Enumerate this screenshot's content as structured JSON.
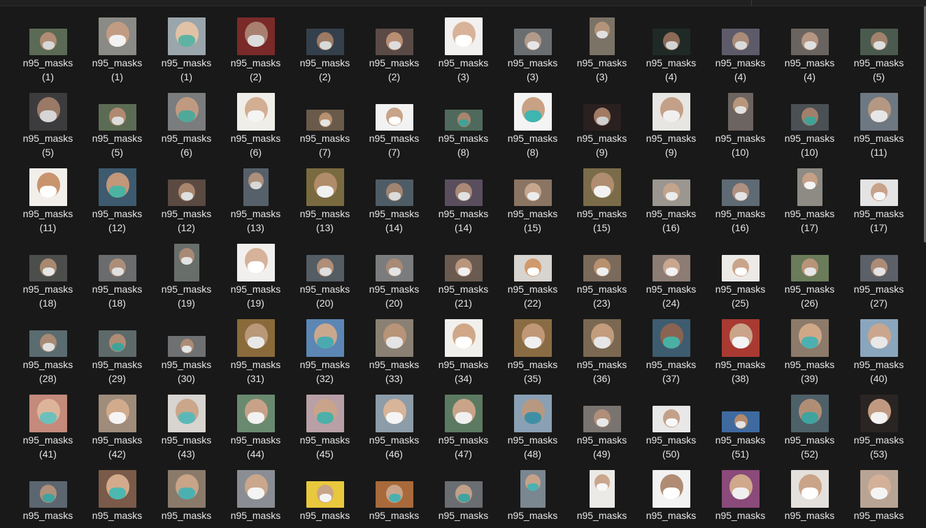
{
  "window": {
    "background": "#191919",
    "text_color": "#e6e6e6"
  },
  "thumbnail_icon": "photo-thumbnail",
  "files": [
    {
      "name": "n95_masks",
      "number": "(1)",
      "bg": "#5b6a55",
      "face": "#b08c74",
      "mask": "#d8d8d8",
      "shape": "wide"
    },
    {
      "name": "n95_masks",
      "number": "(1)",
      "bg": "#8a8a86",
      "face": "#c29c82",
      "mask": "#f2f2f2",
      "shape": "square"
    },
    {
      "name": "n95_masks",
      "number": "(1)",
      "bg": "#9aa6ac",
      "face": "#e2c2a6",
      "mask": "#5fb3a3",
      "shape": "square"
    },
    {
      "name": "n95_masks",
      "number": "(2)",
      "bg": "#7a2a28",
      "face": "#a88070",
      "mask": "#dcdcdc",
      "shape": "square"
    },
    {
      "name": "n95_masks",
      "number": "(2)",
      "bg": "#34404c",
      "face": "#9c7a64",
      "mask": "#d9d9d9",
      "shape": "wide"
    },
    {
      "name": "n95_masks",
      "number": "(2)",
      "bg": "#5a4a46",
      "face": "#b88e72",
      "mask": "#dddddd",
      "shape": "wide"
    },
    {
      "name": "n95_masks",
      "number": "(3)",
      "bg": "#f3f1ef",
      "face": "#d8b39a",
      "mask": "#ffffff",
      "shape": "square"
    },
    {
      "name": "n95_masks",
      "number": "(3)",
      "bg": "#6b6e70",
      "face": "#b29a8a",
      "mask": "#e6e6e6",
      "shape": "wide"
    },
    {
      "name": "n95_masks",
      "number": "(3)",
      "bg": "#7b7366",
      "face": "#b39479",
      "mask": "#e0e0e0",
      "shape": "tall"
    },
    {
      "name": "n95_masks",
      "number": "(4)",
      "bg": "#1f2a26",
      "face": "#8c6a58",
      "mask": "#d4d4d4",
      "shape": "wide"
    },
    {
      "name": "n95_masks",
      "number": "(4)",
      "bg": "#5d5a6a",
      "face": "#a98b78",
      "mask": "#dadada",
      "shape": "wide"
    },
    {
      "name": "n95_masks",
      "number": "(4)",
      "bg": "#6a6460",
      "face": "#b49682",
      "mask": "#e0e0e0",
      "shape": "wide"
    },
    {
      "name": "n95_masks",
      "number": "(5)",
      "bg": "#4b5a4e",
      "face": "#a0826c",
      "mask": "#dedede",
      "shape": "wide"
    },
    {
      "name": "n95_masks",
      "number": "(5)",
      "bg": "#3c3c3e",
      "face": "#9a7a66",
      "mask": "#d6d6d6",
      "shape": "square"
    },
    {
      "name": "n95_masks",
      "number": "(5)",
      "bg": "#5c6c54",
      "face": "#b08a70",
      "mask": "#dcdcdc",
      "shape": "wide"
    },
    {
      "name": "n95_masks",
      "number": "(6)",
      "bg": "#7a7c7e",
      "face": "#c09a80",
      "mask": "#4fa89a",
      "shape": "square"
    },
    {
      "name": "n95_masks",
      "number": "(6)",
      "bg": "#f0eee8",
      "face": "#d2ae92",
      "mask": "#f4f4f4",
      "shape": "square"
    },
    {
      "name": "n95_masks",
      "number": "(7)",
      "bg": "#6a5a4a",
      "face": "#b89070",
      "mask": "#e4e4e4",
      "shape": "flat"
    },
    {
      "name": "n95_masks",
      "number": "(7)",
      "bg": "#f2f2f2",
      "face": "#c8a48a",
      "mask": "#ffffff",
      "shape": "wide"
    },
    {
      "name": "n95_masks",
      "number": "(8)",
      "bg": "#4f6a5c",
      "face": "#a8856e",
      "mask": "#3fa399",
      "shape": "flat"
    },
    {
      "name": "n95_masks",
      "number": "(8)",
      "bg": "#f4f4f4",
      "face": "#c9a184",
      "mask": "#3fb5b0",
      "shape": "square"
    },
    {
      "name": "n95_masks",
      "number": "(9)",
      "bg": "#2a2020",
      "face": "#a27a64",
      "mask": "#d0d0d0",
      "shape": "wide"
    },
    {
      "name": "n95_masks",
      "number": "(9)",
      "bg": "#e8e6e2",
      "face": "#c4a088",
      "mask": "#f0f0f0",
      "shape": "square"
    },
    {
      "name": "n95_masks",
      "number": "(10)",
      "bg": "#6c6460",
      "face": "#b8967c",
      "mask": "#e2e2e2",
      "shape": "tall"
    },
    {
      "name": "n95_masks",
      "number": "(10)",
      "bg": "#4a5054",
      "face": "#a0806a",
      "mask": "#3fa399",
      "shape": "wide"
    },
    {
      "name": "n95_masks",
      "number": "(11)",
      "bg": "#6d7882",
      "face": "#b49884",
      "mask": "#e6e6e6",
      "shape": "square"
    },
    {
      "name": "n95_masks",
      "number": "(11)",
      "bg": "#f2efeb",
      "face": "#c8946e",
      "mask": "#ffffff",
      "shape": "square"
    },
    {
      "name": "n95_masks",
      "number": "(12)",
      "bg": "#3e5a6e",
      "face": "#c2977a",
      "mask": "#4cb3a2",
      "shape": "square"
    },
    {
      "name": "n95_masks",
      "number": "(12)",
      "bg": "#5a4a42",
      "face": "#a8866e",
      "mask": "#e0e0e0",
      "shape": "wide"
    },
    {
      "name": "n95_masks",
      "number": "(13)",
      "bg": "#56606a",
      "face": "#ad8f7c",
      "mask": "#d8d8d8",
      "shape": "tall"
    },
    {
      "name": "n95_masks",
      "number": "(13)",
      "bg": "#7a6a40",
      "face": "#b08c6a",
      "mask": "#f0f0f0",
      "shape": "square"
    },
    {
      "name": "n95_masks",
      "number": "(14)",
      "bg": "#4e5c66",
      "face": "#a08470",
      "mask": "#dcdcdc",
      "shape": "wide"
    },
    {
      "name": "n95_masks",
      "number": "(14)",
      "bg": "#5a4e5e",
      "face": "#aa8a76",
      "mask": "#e2e2e2",
      "shape": "wide"
    },
    {
      "name": "n95_masks",
      "number": "(15)",
      "bg": "#8a7462",
      "face": "#c6a68e",
      "mask": "#ececec",
      "shape": "wide"
    },
    {
      "name": "n95_masks",
      "number": "(15)",
      "bg": "#7a6c48",
      "face": "#b08c70",
      "mask": "#f2f2f2",
      "shape": "square"
    },
    {
      "name": "n95_masks",
      "number": "(16)",
      "bg": "#9c9690",
      "face": "#c4a48c",
      "mask": "#ececec",
      "shape": "wide"
    },
    {
      "name": "n95_masks",
      "number": "(16)",
      "bg": "#5e6a74",
      "face": "#b09080",
      "mask": "#e4e4e4",
      "shape": "wide"
    },
    {
      "name": "n95_masks",
      "number": "(17)",
      "bg": "#8e8a84",
      "face": "#c4a086",
      "mask": "#f4f4f4",
      "shape": "tall"
    },
    {
      "name": "n95_masks",
      "number": "(17)",
      "bg": "#e4e4e4",
      "face": "#c8a28a",
      "mask": "#f8f8f8",
      "shape": "wide"
    },
    {
      "name": "n95_masks",
      "number": "(18)",
      "bg": "#4c4e4c",
      "face": "#a8886e",
      "mask": "#e6e6e6",
      "shape": "wide"
    },
    {
      "name": "n95_masks",
      "number": "(18)",
      "bg": "#6a6c6e",
      "face": "#ac8e78",
      "mask": "#e0e0e0",
      "shape": "wide"
    },
    {
      "name": "n95_masks",
      "number": "(19)",
      "bg": "#686e6a",
      "face": "#a88a74",
      "mask": "#e2e2e2",
      "shape": "tall"
    },
    {
      "name": "n95_masks",
      "number": "(19)",
      "bg": "#f2f0ee",
      "face": "#d6b29a",
      "mask": "#ffffff",
      "shape": "square"
    },
    {
      "name": "n95_masks",
      "number": "(20)",
      "bg": "#545c64",
      "face": "#b08e78",
      "mask": "#dedede",
      "shape": "wide"
    },
    {
      "name": "n95_masks",
      "number": "(20)",
      "bg": "#7a7c7e",
      "face": "#a88a76",
      "mask": "#e4e4e4",
      "shape": "wide"
    },
    {
      "name": "n95_masks",
      "number": "(21)",
      "bg": "#6a5a50",
      "face": "#b8957c",
      "mask": "#f0f0f0",
      "shape": "wide"
    },
    {
      "name": "n95_masks",
      "number": "(22)",
      "bg": "#d8d4d0",
      "face": "#d09a6c",
      "mask": "#ffffff",
      "shape": "wide"
    },
    {
      "name": "n95_masks",
      "number": "(23)",
      "bg": "#7a6a5c",
      "face": "#b8906e",
      "mask": "#eeeeee",
      "shape": "wide"
    },
    {
      "name": "n95_masks",
      "number": "(24)",
      "bg": "#8c7c74",
      "face": "#c8a690",
      "mask": "#f2f2f2",
      "shape": "wide"
    },
    {
      "name": "n95_masks",
      "number": "(25)",
      "bg": "#eceae6",
      "face": "#caa48a",
      "mask": "#ffffff",
      "shape": "wide"
    },
    {
      "name": "n95_masks",
      "number": "(26)",
      "bg": "#6a7c5a",
      "face": "#b89478",
      "mask": "#e6e6e6",
      "shape": "wide"
    },
    {
      "name": "n95_masks",
      "number": "(27)",
      "bg": "#5c6068",
      "face": "#ac8c76",
      "mask": "#e4e4e4",
      "shape": "wide"
    },
    {
      "name": "n95_masks",
      "number": "(28)",
      "bg": "#5a6c70",
      "face": "#a88a74",
      "mask": "#e0e0e0",
      "shape": "wide"
    },
    {
      "name": "n95_masks",
      "number": "(29)",
      "bg": "#5e6a6a",
      "face": "#b08c74",
      "mask": "#3fa399",
      "shape": "wide"
    },
    {
      "name": "n95_masks",
      "number": "(30)",
      "bg": "#6e7072",
      "face": "#ac8c76",
      "mask": "#e4e4e4",
      "shape": "flat"
    },
    {
      "name": "n95_masks",
      "number": "(31)",
      "bg": "#8a6a3a",
      "face": "#b89878",
      "mask": "#e8e8e8",
      "shape": "square"
    },
    {
      "name": "n95_masks",
      "number": "(32)",
      "bg": "#5c86b4",
      "face": "#caa88e",
      "mask": "#4aaab0",
      "shape": "square"
    },
    {
      "name": "n95_masks",
      "number": "(33)",
      "bg": "#8a8074",
      "face": "#b89478",
      "mask": "#e4e4e4",
      "shape": "square"
    },
    {
      "name": "n95_masks",
      "number": "(34)",
      "bg": "#f2f0ec",
      "face": "#d0a888",
      "mask": "#ffffff",
      "shape": "square"
    },
    {
      "name": "n95_masks",
      "number": "(35)",
      "bg": "#8a6c44",
      "face": "#c09878",
      "mask": "#f0f0f0",
      "shape": "square"
    },
    {
      "name": "n95_masks",
      "number": "(36)",
      "bg": "#7a6852",
      "face": "#c29c7c",
      "mask": "#e6e6e6",
      "shape": "square"
    },
    {
      "name": "n95_masks",
      "number": "(37)",
      "bg": "#3e5c70",
      "face": "#8a6450",
      "mask": "#4ab0a4",
      "shape": "square"
    },
    {
      "name": "n95_masks",
      "number": "(38)",
      "bg": "#a83a32",
      "face": "#caa48a",
      "mask": "#f4f4f4",
      "shape": "square"
    },
    {
      "name": "n95_masks",
      "number": "(39)",
      "bg": "#8c7a6a",
      "face": "#d0a888",
      "mask": "#4cb0b0",
      "shape": "square"
    },
    {
      "name": "n95_masks",
      "number": "(40)",
      "bg": "#8aa6bc",
      "face": "#caa68e",
      "mask": "#e8e8e8",
      "shape": "square"
    },
    {
      "name": "n95_masks",
      "number": "(41)",
      "bg": "#c48a7c",
      "face": "#dcb49a",
      "mask": "#6cc0bc",
      "shape": "square"
    },
    {
      "name": "n95_masks",
      "number": "(42)",
      "bg": "#a08c7a",
      "face": "#d2aa8c",
      "mask": "#f4f4f4",
      "shape": "square"
    },
    {
      "name": "n95_masks",
      "number": "(43)",
      "bg": "#d8d4d0",
      "face": "#caa68a",
      "mask": "#5cb8b8",
      "shape": "square"
    },
    {
      "name": "n95_masks",
      "number": "(44)",
      "bg": "#6a8a70",
      "face": "#c8a288",
      "mask": "#f2f2f2",
      "shape": "square"
    },
    {
      "name": "n95_masks",
      "number": "(45)",
      "bg": "#b8a0a6",
      "face": "#caa48a",
      "mask": "#4cb0a8",
      "shape": "square"
    },
    {
      "name": "n95_masks",
      "number": "(46)",
      "bg": "#8c9ca8",
      "face": "#d8b498",
      "mask": "#f4f4f4",
      "shape": "square"
    },
    {
      "name": "n95_masks",
      "number": "(47)",
      "bg": "#5c7a62",
      "face": "#caa488",
      "mask": "#f0f0f0",
      "shape": "square"
    },
    {
      "name": "n95_masks",
      "number": "(48)",
      "bg": "#8aa0b4",
      "face": "#b89880",
      "mask": "#3f8fa4",
      "shape": "square"
    },
    {
      "name": "n95_masks",
      "number": "(49)",
      "bg": "#7a7470",
      "face": "#b08e78",
      "mask": "#e8e8e8",
      "shape": "wide"
    },
    {
      "name": "n95_masks",
      "number": "(50)",
      "bg": "#e8e8e8",
      "face": "#c4a088",
      "mask": "#f8f8f8",
      "shape": "wide"
    },
    {
      "name": "n95_masks",
      "number": "(51)",
      "bg": "#3e6aa0",
      "face": "#b48a6c",
      "mask": "#e4e4e4",
      "shape": "flat"
    },
    {
      "name": "n95_masks",
      "number": "(52)",
      "bg": "#4e6068",
      "face": "#b08e76",
      "mask": "#3fa3a0",
      "shape": "square"
    },
    {
      "name": "n95_masks",
      "number": "(53)",
      "bg": "#2a2422",
      "face": "#c09a80",
      "mask": "#f2f2f2",
      "shape": "square"
    },
    {
      "name": "n95_masks",
      "number": "",
      "bg": "#5c6670",
      "face": "#b0907a",
      "mask": "#3fa3a0",
      "shape": "wide"
    },
    {
      "name": "n95_masks",
      "number": "",
      "bg": "#7a5a48",
      "face": "#d4aa8c",
      "mask": "#4cb8b0",
      "shape": "square"
    },
    {
      "name": "n95_masks",
      "number": "",
      "bg": "#8a7a6a",
      "face": "#c8a488",
      "mask": "#4cb0b0",
      "shape": "square"
    },
    {
      "name": "n95_masks",
      "number": "",
      "bg": "#8a8e94",
      "face": "#caa68c",
      "mask": "#f4f4f4",
      "shape": "square"
    },
    {
      "name": "n95_masks",
      "number": "",
      "bg": "#e8c83c",
      "face": "#c8a488",
      "mask": "#f4f4f4",
      "shape": "wide"
    },
    {
      "name": "n95_masks",
      "number": "",
      "bg": "#a86a3a",
      "face": "#caa48a",
      "mask": "#4cb0b0",
      "shape": "wide"
    },
    {
      "name": "n95_masks",
      "number": "",
      "bg": "#6a6e72",
      "face": "#c0a088",
      "mask": "#3fa3a0",
      "shape": "wide"
    },
    {
      "name": "n95_masks",
      "number": "",
      "bg": "#7a8690",
      "face": "#c4a28a",
      "mask": "#4cb0b0",
      "shape": "tall"
    },
    {
      "name": "n95_masks",
      "number": "",
      "bg": "#eceae6",
      "face": "#caa68e",
      "mask": "#f8f8f8",
      "shape": "tall"
    },
    {
      "name": "n95_masks",
      "number": "",
      "bg": "#f2f2f2",
      "face": "#b08c74",
      "mask": "#ffffff",
      "shape": "square"
    },
    {
      "name": "n95_masks",
      "number": "",
      "bg": "#8a4a7a",
      "face": "#d0a88c",
      "mask": "#f0f0f0",
      "shape": "square"
    },
    {
      "name": "n95_masks",
      "number": "",
      "bg": "#e4e0dc",
      "face": "#caa488",
      "mask": "#ffffff",
      "shape": "square"
    },
    {
      "name": "n95_masks",
      "number": "",
      "bg": "#b8a494",
      "face": "#d4b098",
      "mask": "#f4f4f4",
      "shape": "square"
    }
  ]
}
